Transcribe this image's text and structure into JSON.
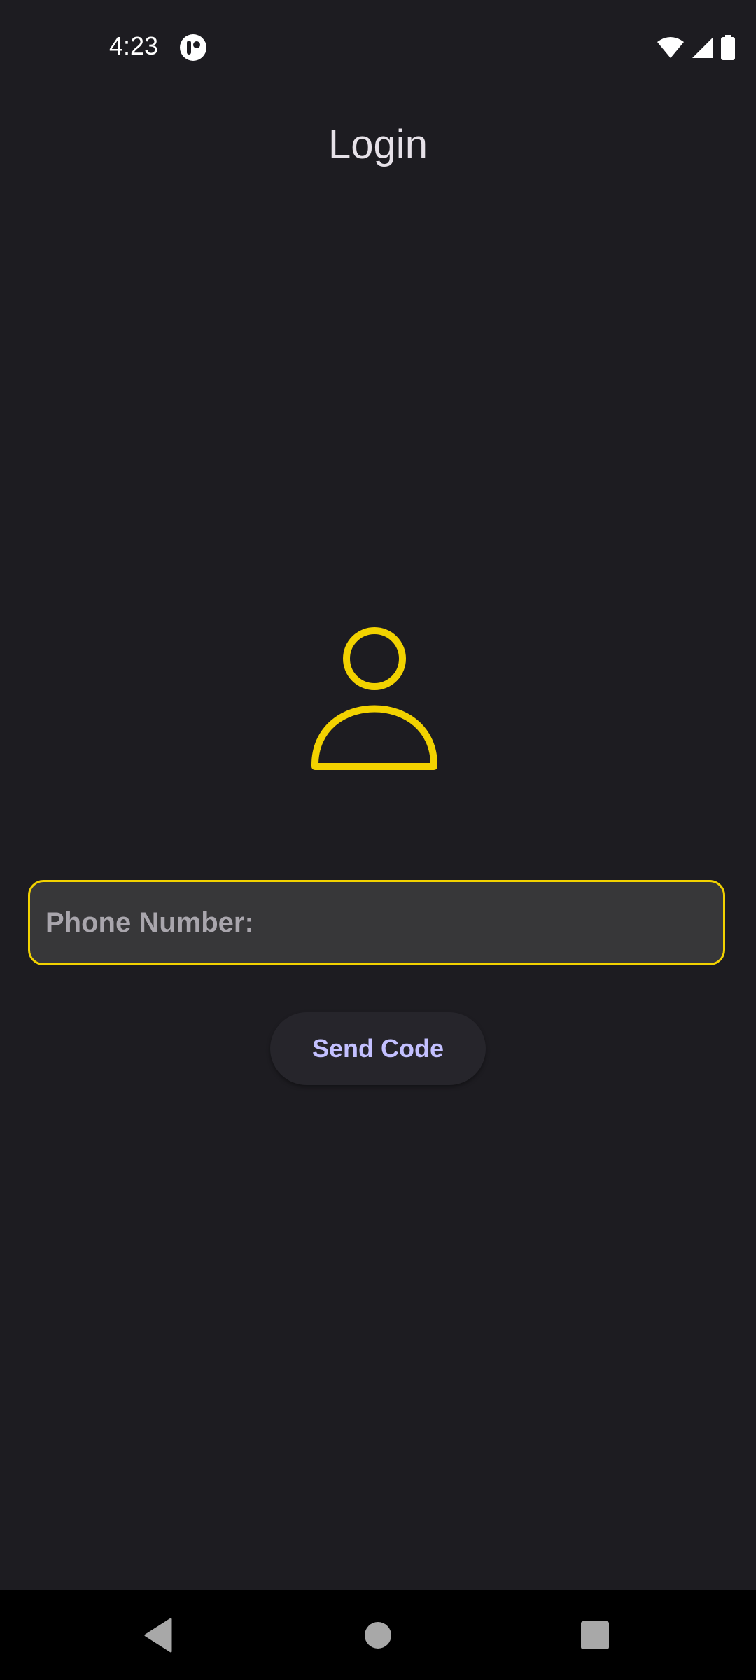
{
  "status_bar": {
    "time": "4:23",
    "app_icon": "app-notification-icon",
    "icons": [
      "wifi-icon",
      "cellular-signal-icon",
      "battery-icon"
    ]
  },
  "header": {
    "title": "Login"
  },
  "avatar": {
    "icon": "user-icon",
    "color": "#f2d200"
  },
  "form": {
    "phone_placeholder": "Phone Number:",
    "phone_value": "",
    "send_button_label": "Send Code"
  },
  "nav_bar": {
    "buttons": [
      "back-icon",
      "home-icon",
      "recents-icon"
    ]
  },
  "colors": {
    "background": "#1d1c21",
    "accent": "#f2d200",
    "button_text": "#c3c0ff",
    "field_background": "#373739"
  }
}
